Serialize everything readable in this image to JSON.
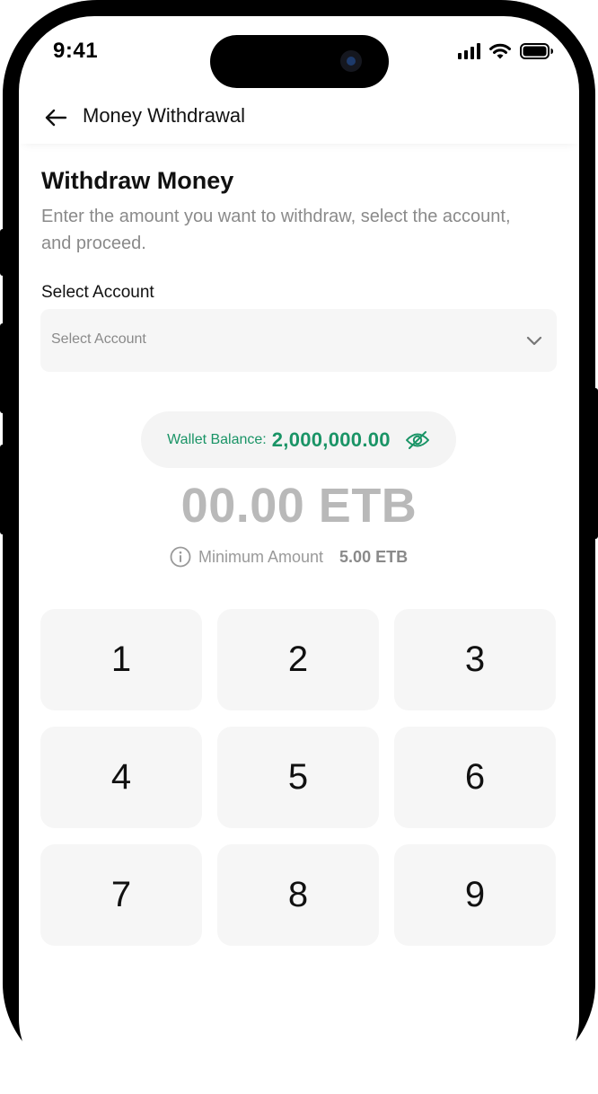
{
  "status": {
    "time": "9:41"
  },
  "header": {
    "title": "Money Withdrawal"
  },
  "page": {
    "title": "Withdraw Money",
    "subtitle": "Enter the amount you want to withdraw, select the account, and proceed."
  },
  "account": {
    "label": "Select Account",
    "placeholder": "Select Account"
  },
  "wallet": {
    "label": "Wallet Balance:",
    "value": "2,000,000.00",
    "accent": "#1a9466"
  },
  "amount": {
    "display": "00.00 ETB"
  },
  "minimum": {
    "label": "Minimum Amount",
    "value": "5.00 ETB"
  },
  "keypad": {
    "keys": [
      "1",
      "2",
      "3",
      "4",
      "5",
      "6",
      "7",
      "8",
      "9"
    ]
  },
  "icons": {
    "back": "arrow-left-icon",
    "chevron": "chevron-down-icon",
    "visibility": "eye-off-icon",
    "info": "info-icon"
  }
}
